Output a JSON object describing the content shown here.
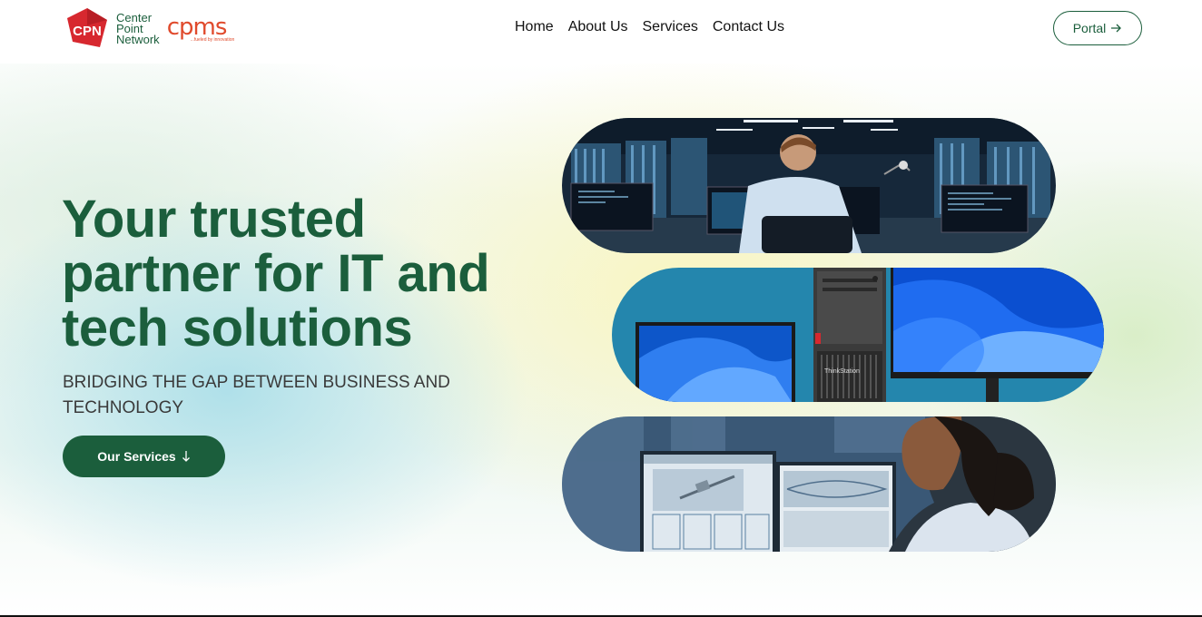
{
  "header": {
    "logo": {
      "mark_letters": "CPN",
      "name_lines": [
        "Center",
        "Point",
        "Network"
      ],
      "secondary_brand": "cpms",
      "secondary_tagline": "...fueled by innovation"
    },
    "nav": [
      {
        "label": "Home"
      },
      {
        "label": "About Us"
      },
      {
        "label": "Services"
      },
      {
        "label": "Contact Us"
      }
    ],
    "portal": {
      "label": "Portal",
      "icon": "arrow-right-icon"
    }
  },
  "hero": {
    "headline_lines": [
      "Your trusted",
      "partner for IT and",
      "tech solutions"
    ],
    "subheading": "BRIDGING THE GAP BETWEEN BUSINESS AND TECHNOLOGY",
    "cta": {
      "label": "Our Services",
      "icon": "arrow-down-icon"
    },
    "images": [
      {
        "name": "data-center-engineer-photo"
      },
      {
        "name": "workstation-monitors-photo",
        "brand_text": "ThinkStation"
      },
      {
        "name": "satellite-engineer-photo"
      }
    ]
  },
  "colors": {
    "brand_green": "#1b5e3c",
    "brand_red": "#d7282f",
    "cpms_orange": "#e04a2c",
    "text_dark": "#111111"
  }
}
